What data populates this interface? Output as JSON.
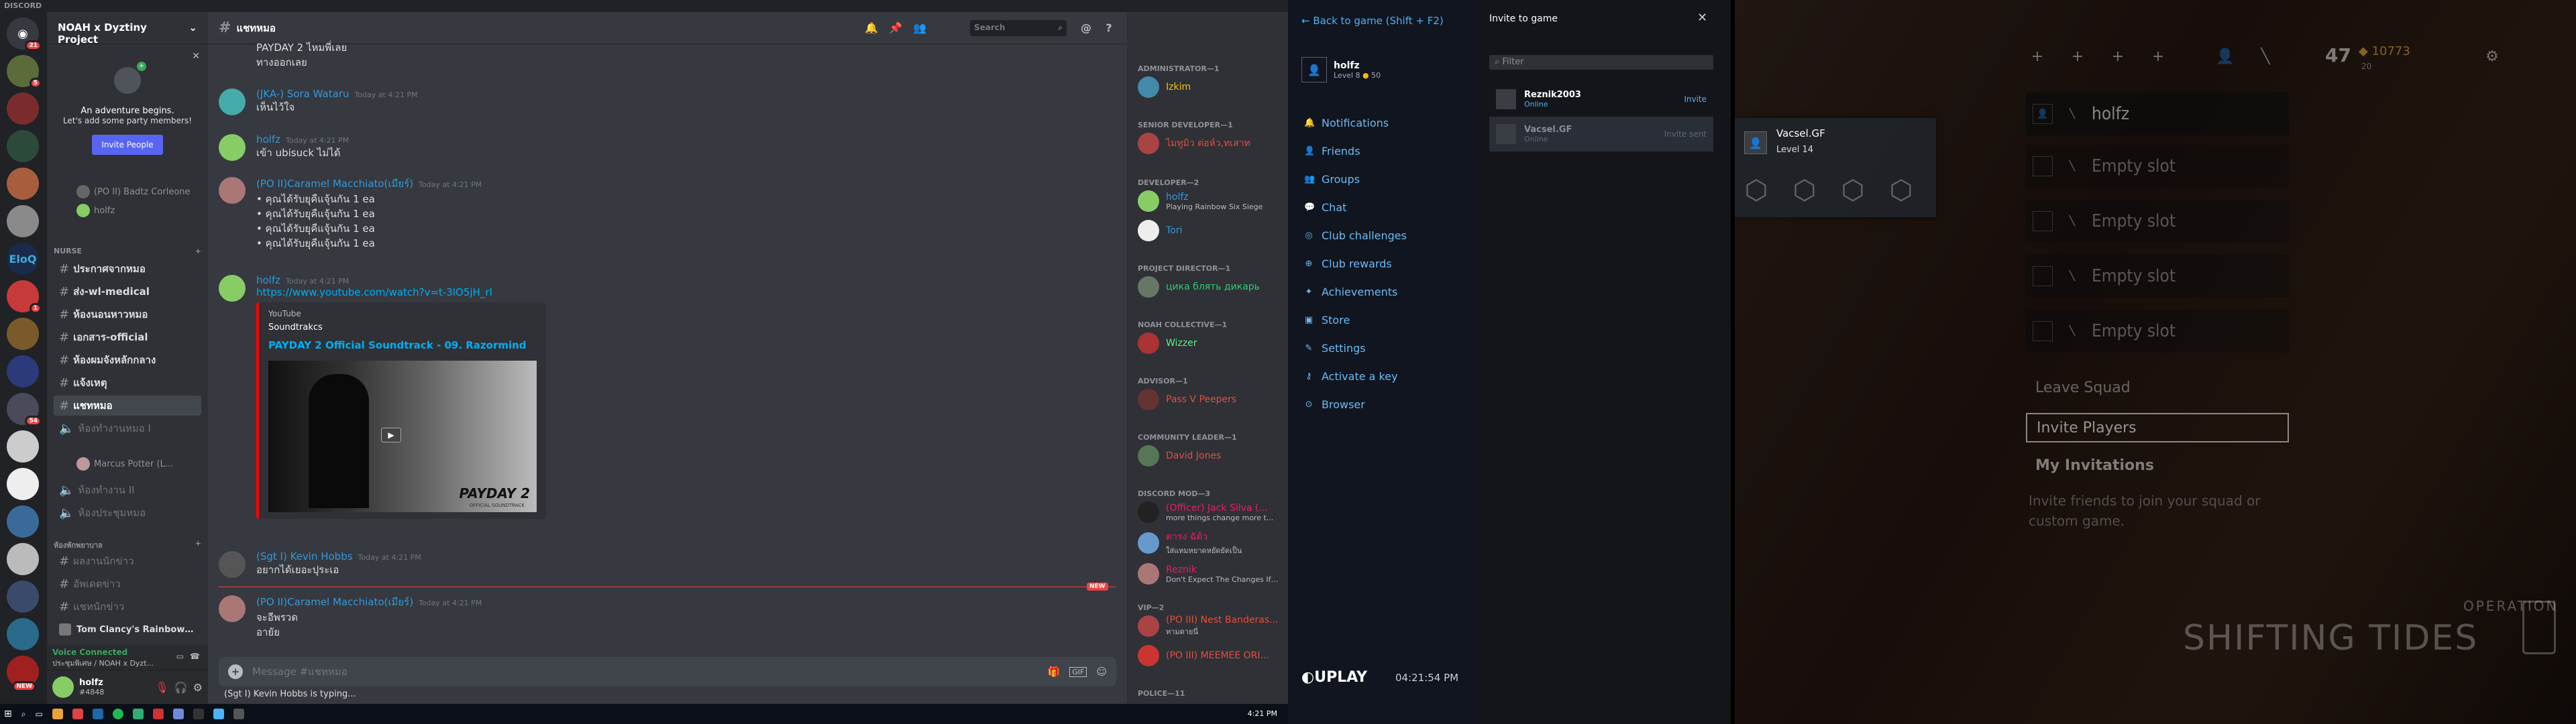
{
  "discord": {
    "window_title": "DISCORD",
    "guild_name": "NOAH x Dyztiny Project",
    "guild_badges": [
      "21",
      "5",
      "54",
      "1",
      "1",
      "NEW"
    ],
    "invite": {
      "title": "An adventure begins.",
      "subtitle": "Let's add some party members!",
      "button": "Invite People"
    },
    "voice_users_top": [
      "(PO II) Badtz Corleone",
      "holfz"
    ],
    "categories": [
      "NURSE",
      "ห้องพักพยาบาล"
    ],
    "channels": [
      "ประกาศจากหมอ",
      "ส่ง-wl-medical",
      "ห้องนอนหาวหมอ",
      "เอกสาร-official",
      "ห้องผมจังหลักกลาง",
      "แจ้งเหตุ",
      "แชทหมอ",
      "ห้องทำงานหมอ I",
      "ห้องทำงาน II",
      "ห้องประชุมหมอ",
      "ผลงานนักข่าว",
      "อัพเดตข่าว",
      "แชทนักข่าว",
      "Tom Clancy's Rainbow ..."
    ],
    "voice_user_channel": "Marcus Potter (L...",
    "voice": {
      "status": "Voice Connected",
      "channel": "ประชุมพิเศษ / NOAH x Dyzt..."
    },
    "user": {
      "name": "holfz",
      "tag": "#4848"
    },
    "chat": {
      "channel": "แชทหมอ",
      "search_placeholder": "Search",
      "messages": [
        {
          "author": "",
          "time": "",
          "lines": [
            "PAYDAY 2 ไหมพี่เลย",
            "ทางออกเลย"
          ],
          "color": "#ffffff"
        },
        {
          "author": "(JKA-) Sora Wataru",
          "time": "Today at 4:21 PM",
          "lines": [
            "เห็นไว้ใจ"
          ],
          "color": "#3498db"
        },
        {
          "author": "holfz",
          "time": "Today at 4:21 PM",
          "lines": [
            "เข้า ubisuck ไม่ได้"
          ],
          "color": "#3498db"
        },
        {
          "author": "(PO II)Caramel Macchiato(เมียร์)",
          "time": "Today at 4:21 PM",
          "lines": [
            "• คุณได้รับยุคืแจุ้นกัน 1 ea",
            "• คุณได้รับยุคืแจุ้นกัน 1 ea",
            "• คุณได้รับยุคืแจุ้นกัน 1 ea",
            "• คุณได้รับยุคืแจุ้นกัน 1 ea"
          ],
          "color": "#3498db"
        },
        {
          "author": "holfz",
          "time": "Today at 4:21 PM",
          "lines": [],
          "link": "https://www.youtube.com/watch?v=t-3lO5jH_rI",
          "color": "#3498db"
        },
        {
          "author": "(Sgt I) Kevin Hobbs",
          "time": "Today at 4:21 PM",
          "lines": [
            "อยากได้เยอะปุระเอ"
          ],
          "color": "#3498db"
        },
        {
          "author": "(PO II)Caramel Macchiato(เมียร์)",
          "time": "Today at 4:21 PM",
          "lines": [
            "จะอีพรวด",
            "อายัย"
          ],
          "color": "#3498db"
        }
      ],
      "embed": {
        "provider": "YouTube",
        "author": "Soundtrakcs",
        "title": "PAYDAY 2 Official Soundtrack - 09. Razormind",
        "thumb_text": "PAYDAY 2",
        "thumb_sub": "OFFICIAL SOUNDTRACK"
      },
      "new_tag": "NEW",
      "composer_placeholder": "Message #แชทหมอ",
      "typing": "(Sgt I) Kevin Hobbs is typing..."
    },
    "members": [
      {
        "cat": "ADMINISTRATOR—1",
        "name": "Izkim",
        "color": "#f1c40f",
        "status": ""
      },
      {
        "cat": "SENIOR DEVELOPER—1",
        "name": "ไมทูมิว ต่อห์ว,ทเสาท",
        "color": "#e74c3c",
        "status": ""
      },
      {
        "cat": "DEVELOPER—2",
        "name": "holfz",
        "color": "#3498db",
        "status": "Playing Rainbow Six Siege"
      },
      {
        "cat": "",
        "name": "Tori",
        "color": "#3498db",
        "status": ""
      },
      {
        "cat": "PROJECT DIRECTOR—1",
        "name": "цика блять дикарь",
        "color": "#2ecc71",
        "status": ""
      },
      {
        "cat": "NOAH COLLECTIVE—1",
        "name": "Wizzer",
        "color": "#57f287",
        "status": ""
      },
      {
        "cat": "ADVISOR—1",
        "name": "Pass V Peepers",
        "color": "#e74c3c",
        "status": ""
      },
      {
        "cat": "COMMUNITY LEADER—1",
        "name": "David Jones",
        "color": "#e74c3c",
        "status": ""
      },
      {
        "cat": "DISCORD MOD—3",
        "name": "(Officer) Jack Silva (...",
        "color": "#e91e63",
        "status": "more things change more t..."
      },
      {
        "cat": "",
        "name": "ตารง ฉัต้ว",
        "color": "#e91e63",
        "status": "ใส่แหมหยาดหยัดยัดเป็น"
      },
      {
        "cat": "",
        "name": "Reznik",
        "color": "#e91e63",
        "status": "Don't Expect The Changes If St..."
      },
      {
        "cat": "VIP—2",
        "name": "(PO III) Nest Banderas...",
        "color": "#e74c3c",
        "status": "ทามตายนี่"
      },
      {
        "cat": "",
        "name": "(PO III) MEEMEE ORI...",
        "color": "#e74c3c",
        "status": ""
      },
      {
        "cat": "POLICE—11",
        "name": "",
        "color": "#ffffff",
        "status": ""
      }
    ],
    "taskbar_clock": "4:21 PM"
  },
  "uplay": {
    "back_label": "Back to game (Shift + F2)",
    "profile": {
      "name": "holfz",
      "level": "Level 8",
      "coins": "50"
    },
    "menu": [
      "Notifications",
      "Friends",
      "Groups",
      "Chat",
      "Club challenges",
      "Club rewards",
      "Achievements",
      "Store",
      "Settings",
      "Activate a key",
      "Browser"
    ],
    "logo": "UPLAY",
    "clock": "04:21:54 PM",
    "invite_title": "Invite to game",
    "filter_placeholder": "Filter",
    "friends": [
      {
        "name": "Reznik2003",
        "status": "Online",
        "action": "Invite"
      },
      {
        "name": "Vacsel.GF",
        "status": "Online",
        "action": "Invite sent"
      }
    ],
    "accent": "#4cb3f5"
  },
  "r6": {
    "renown": "47",
    "credits": "10773",
    "credits_sub": "20",
    "squad_leader": "holfz",
    "slots": [
      "Empty slot",
      "Empty slot",
      "Empty slot",
      "Empty slot"
    ],
    "buttons": [
      "Leave Squad",
      "Invite Players",
      "My Invitations"
    ],
    "hint": "Invite friends to join your squad or custom game.",
    "profile_card": {
      "name": "Vacsel.GF",
      "level": "Level 14"
    },
    "operation_label": "OPERATION",
    "operation_name": "SHIFTING TIDES"
  }
}
